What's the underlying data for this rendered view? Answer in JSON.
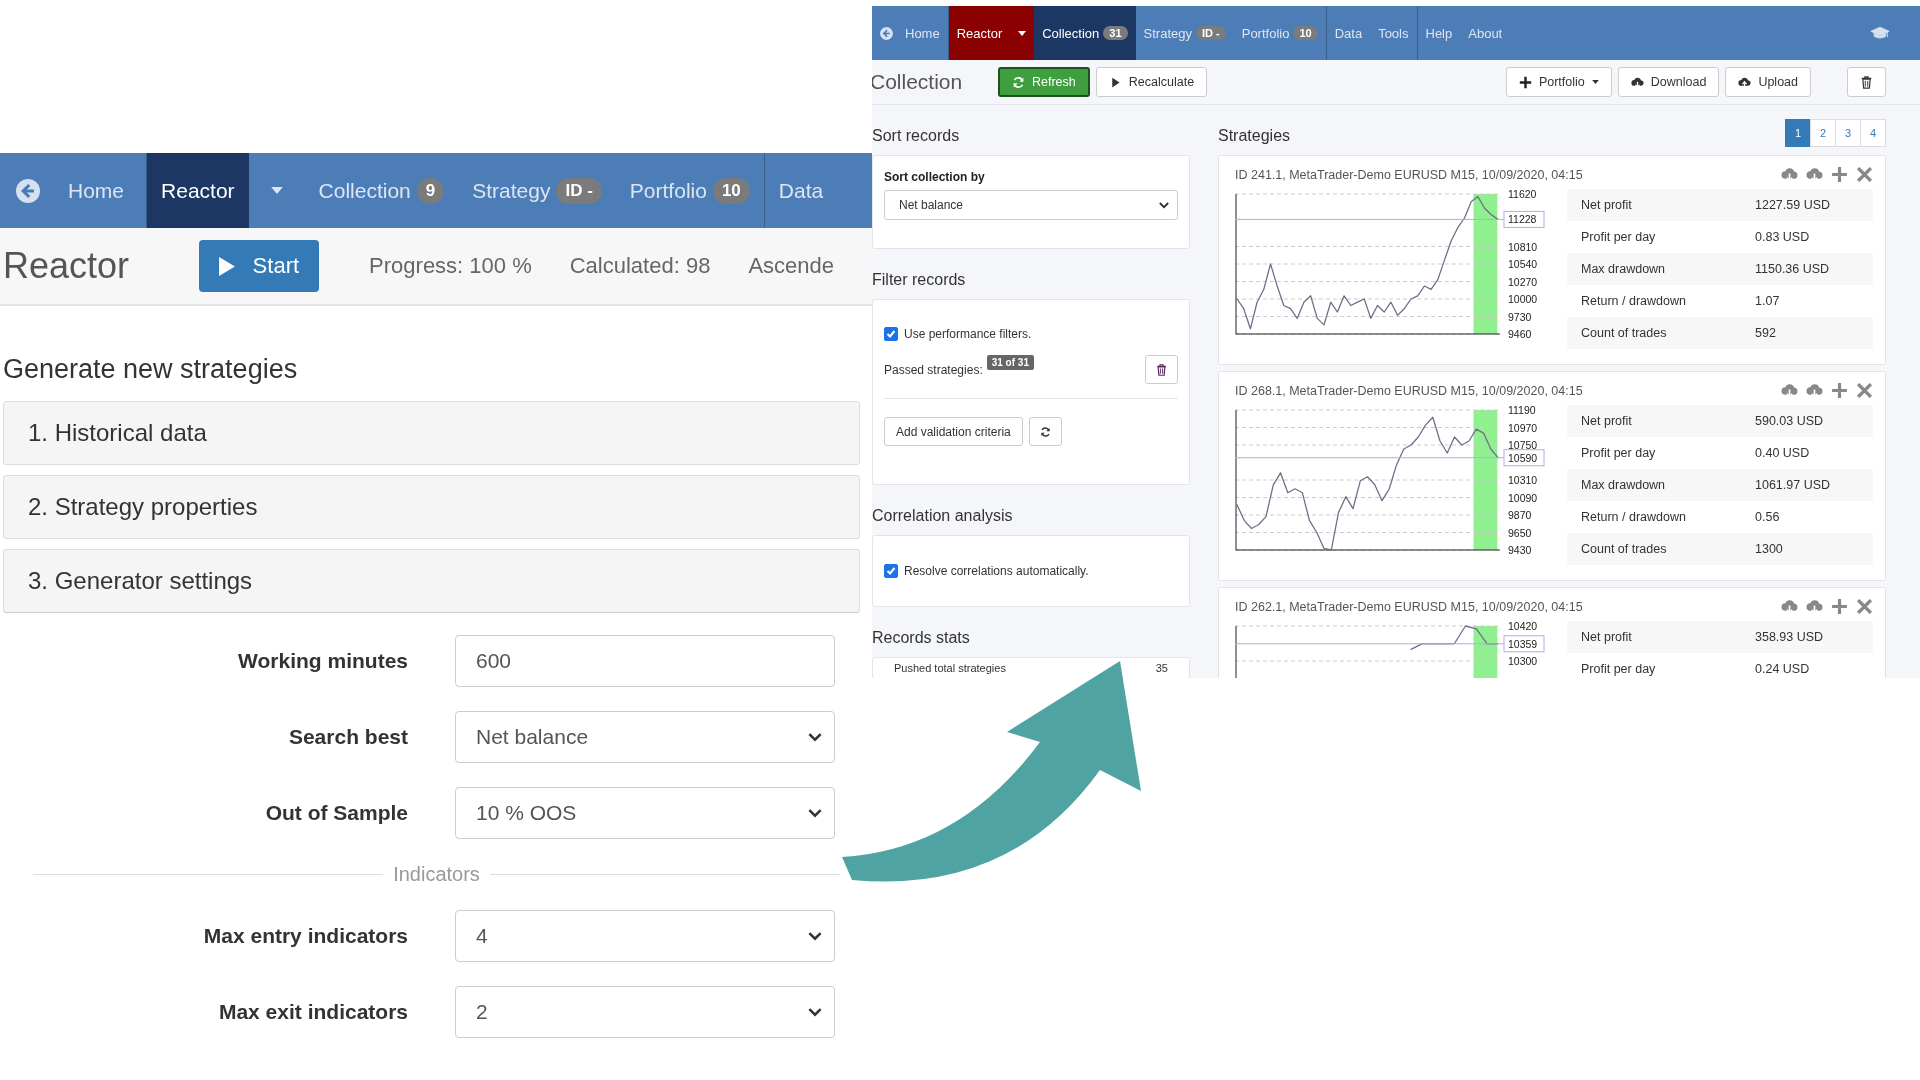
{
  "left_screen": {
    "nav": [
      [
        {
          "kind": "home",
          "label": "Home",
          "selected": false
        }
      ],
      [
        {
          "kind": "link",
          "label": "Reactor",
          "selected": true
        },
        {
          "kind": "caret",
          "selected": false
        },
        {
          "kind": "link",
          "label": "Collection",
          "badge": "9",
          "selected": false
        },
        {
          "kind": "link",
          "label": "Strategy",
          "badge": "ID -",
          "selected": false
        },
        {
          "kind": "link",
          "label": "Portfolio",
          "badge": "10",
          "selected": false
        }
      ],
      [
        {
          "kind": "link",
          "label": "Data",
          "selected": false
        }
      ]
    ],
    "toolbar": {
      "title": "Reactor",
      "start_button": "Start",
      "stats": [
        "Progress: 100 %",
        "Calculated: 98",
        "Ascende"
      ]
    },
    "heading": "Generate new strategies",
    "sections": [
      {
        "label": "1. Historical data",
        "expanded": false
      },
      {
        "label": "2. Strategy properties",
        "expanded": false
      },
      {
        "label": "3. Generator settings",
        "expanded": true
      }
    ],
    "form": [
      {
        "kind": "input",
        "label": "Working minutes",
        "value": "600"
      },
      {
        "kind": "select",
        "label": "Search best",
        "value": "Net balance"
      },
      {
        "kind": "select",
        "label": "Out of Sample",
        "value": "10 % OOS"
      },
      {
        "kind": "divider",
        "label": "Indicators"
      },
      {
        "kind": "select",
        "label": "Max entry indicators",
        "value": "4"
      },
      {
        "kind": "select",
        "label": "Max exit indicators",
        "value": "2"
      }
    ]
  },
  "right_screen": {
    "nav": [
      [
        {
          "kind": "home",
          "label": "Home",
          "selected": false,
          "running": false
        }
      ],
      [
        {
          "kind": "link",
          "label": "Reactor",
          "selected": false,
          "running": true
        },
        {
          "kind": "caret",
          "selected": false,
          "running": true
        },
        {
          "kind": "link",
          "label": "Collection",
          "badge": "31",
          "selected": true,
          "running": false
        },
        {
          "kind": "link",
          "label": "Strategy",
          "badge": "ID -",
          "selected": false,
          "running": false
        },
        {
          "kind": "link",
          "label": "Portfolio",
          "badge": "10",
          "selected": false,
          "running": false
        }
      ],
      [
        {
          "kind": "link",
          "label": "Data",
          "selected": false,
          "running": false
        },
        {
          "kind": "link",
          "label": "Tools",
          "selected": false,
          "running": false
        }
      ],
      [
        {
          "kind": "link",
          "label": "Help",
          "selected": false,
          "running": false
        },
        {
          "kind": "link",
          "label": "About",
          "selected": false,
          "running": false
        }
      ]
    ],
    "toolbar": {
      "title": "Collection",
      "actions_left": [
        {
          "label": "Refresh",
          "kind": "success"
        },
        {
          "label": "Recalculate",
          "kind": "default"
        }
      ],
      "actions_right": [
        {
          "label": "Portfolio",
          "kind": "dropdown"
        },
        {
          "label": "Download",
          "kind": "default"
        },
        {
          "label": "Upload",
          "kind": "default"
        }
      ]
    },
    "sort": {
      "title": "Sort records",
      "label": "Sort collection by",
      "value": "Net balance"
    },
    "filter": {
      "title": "Filter records",
      "checkbox": {
        "label": "Use performance filters.",
        "checked": true
      },
      "passed_label": "Passed strategies:",
      "passed_badge": "31 of 31",
      "add_button": "Add validation criteria"
    },
    "correlation": {
      "title": "Correlation analysis",
      "checkbox": {
        "label": "Resolve correlations automatically.",
        "checked": true
      }
    },
    "records_stats": {
      "title": "Records stats",
      "rows": [
        {
          "label": "Pushed total strategies",
          "value": "35"
        }
      ]
    },
    "strategies": {
      "title": "Strategies",
      "pages": [
        {
          "label": "1",
          "selected": true
        },
        {
          "label": "2",
          "selected": false
        },
        {
          "label": "3",
          "selected": false
        },
        {
          "label": "4",
          "selected": false
        }
      ],
      "cards": [
        {
          "title": "ID 241.1, MetaTrader-Demo EURUSD M15, 10/09/2020, 04:15",
          "chart_data": {
            "type": "line",
            "ylim": [
              9460,
              11620
            ],
            "yticks": [
              9460,
              9730,
              10000,
              10270,
              10540,
              10810,
              11620
            ],
            "grid": true,
            "ref_lines": [
              {
                "axis": "y",
                "value": 11228,
                "label": "11228"
              }
            ],
            "series": [
              {
                "color": "#7a6a8a",
                "values": [
                  10000,
                  9850,
                  9540,
                  9950,
                  10150,
                  10540,
                  10200,
                  9900,
                  9850,
                  9700,
                  9950,
                  10050,
                  9700,
                  9600,
                  9950,
                  9800,
                  10050,
                  9900,
                  9950,
                  10000,
                  9700,
                  9900,
                  9800,
                  9950,
                  9750,
                  9850,
                  10000,
                  10050,
                  10200,
                  10150,
                  10300,
                  10600,
                  10900,
                  11100,
                  11250,
                  11500,
                  11580,
                  11400,
                  11300,
                  11228
                ]
              }
            ]
          },
          "stats": [
            {
              "label": "Net profit",
              "value": "1227.59 USD"
            },
            {
              "label": "Profit per day",
              "value": "0.83 USD"
            },
            {
              "label": "Max drawdown",
              "value": "1150.36 USD"
            },
            {
              "label": "Return / drawdown",
              "value": "1.07"
            },
            {
              "label": "Count of trades",
              "value": "592"
            }
          ]
        },
        {
          "title": "ID 268.1, MetaTrader-Demo EURUSD M15, 10/09/2020, 04:15",
          "chart_data": {
            "type": "line",
            "ylim": [
              9430,
              11190
            ],
            "yticks": [
              9430,
              9650,
              9870,
              10090,
              10310,
              10750,
              10970,
              11190
            ],
            "grid": true,
            "ref_lines": [
              {
                "axis": "y",
                "value": 10590,
                "label": "10590"
              }
            ],
            "series": [
              {
                "color": "#7a6a8a",
                "values": [
                  10000,
                  9800,
                  9700,
                  9750,
                  9850,
                  10250,
                  10400,
                  10150,
                  10200,
                  10150,
                  9800,
                  9650,
                  9450,
                  9430,
                  9900,
                  10100,
                  9950,
                  10300,
                  10350,
                  10250,
                  10050,
                  10200,
                  10500,
                  10700,
                  10750,
                  10850,
                  11000,
                  11100,
                  10800,
                  10650,
                  10850,
                  10750,
                  10800,
                  10950,
                  10900,
                  10700,
                  10590
                ]
              }
            ]
          },
          "stats": [
            {
              "label": "Net profit",
              "value": "590.03 USD"
            },
            {
              "label": "Profit per day",
              "value": "0.40 USD"
            },
            {
              "label": "Max drawdown",
              "value": "1061.97 USD"
            },
            {
              "label": "Return / drawdown",
              "value": "0.56"
            },
            {
              "label": "Count of trades",
              "value": "1300"
            }
          ]
        },
        {
          "title": "ID 262.1, MetaTrader-Demo EURUSD M15, 10/09/2020, 04:15",
          "chart_data": {
            "type": "line",
            "ylim": [
              9940,
              10420
            ],
            "yticks": [
              10300,
              10420
            ],
            "grid": true,
            "ref_lines": [
              {
                "axis": "y",
                "value": 10359,
                "label": "10359"
              }
            ],
            "series": [
              {
                "color": "#7a6a8a",
                "values": [
                  null,
                  null,
                  null,
                  null,
                  null,
                  null,
                  null,
                  null,
                  null,
                  null,
                  null,
                  null,
                  null,
                  null,
                  null,
                  null,
                  10340,
                  10359,
                  10359,
                  10359,
                  10360,
                  10420,
                  10410,
                  10359,
                  10359
                ]
              }
            ]
          },
          "stats": [
            {
              "label": "Net profit",
              "value": "358.93 USD"
            },
            {
              "label": "Profit per day",
              "value": "0.24 USD"
            }
          ]
        }
      ]
    }
  }
}
